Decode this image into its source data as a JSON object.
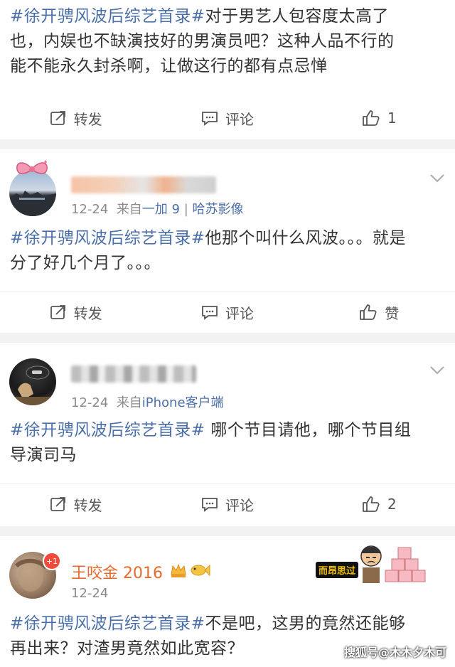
{
  "colors": {
    "hashtag": "#4b6fa8",
    "username_vip": "#e86a2c",
    "meta": "#8a8a8a",
    "background": "#f2f2f2"
  },
  "posts": [
    {
      "text_tag": "#徐开骋风波后综艺首录#",
      "text_line1_rest": "对于男艺人包容度太高了",
      "text_line2": "也，内娱也不缺演技好的男演员吧？这种人品不行的",
      "text_line3": "能不能永久封杀啊，让做这行的都有点忌惮",
      "actions": {
        "repost": "转发",
        "comment": "评论",
        "like": "1"
      }
    },
    {
      "date": "12-24",
      "source_prefix": "来自",
      "source": "一加 9",
      "source_sep": "|",
      "source2": "哈苏影像",
      "text_tag": "#徐开骋风波后综艺首录#",
      "text_line1_rest": "他那个叫什么风波。。。就是",
      "text_line2": "分了好几个月了。。。",
      "actions": {
        "repost": "转发",
        "comment": "评论",
        "like": "赞"
      }
    },
    {
      "date": "12-24",
      "source_prefix": "来自",
      "source": "iPhone客户端",
      "text_tag": "#徐开骋风波后综艺首录#",
      "text_line1_rest": " 哪个节目请他，哪个节目组",
      "text_line2": "导演司马",
      "actions": {
        "repost": "转发",
        "comment": "评论",
        "like": "2"
      }
    },
    {
      "username": "王咬金 2016",
      "badge": "+1",
      "date": "12-24",
      "sticker_text": "而昂思过",
      "text_tag": "#徐开骋风波后综艺首录#",
      "text_line1_rest": "不是吧，这男的竟然还能够",
      "text_line2": "再出来？对渣男竟然如此宽容？"
    }
  ],
  "watermark": "搜狐号@木木夕木可"
}
